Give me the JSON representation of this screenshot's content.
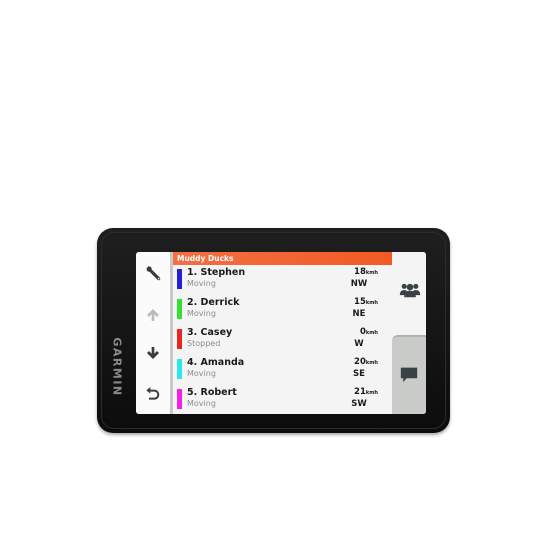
{
  "device": {
    "brand": "GARMIN"
  },
  "sidebar": {
    "buttons": [
      {
        "name": "settings",
        "icon": "wrench-icon"
      },
      {
        "name": "scroll-up",
        "icon": "arrow-up-icon"
      },
      {
        "name": "scroll-down",
        "icon": "arrow-down-icon"
      },
      {
        "name": "back",
        "icon": "back-arrow-icon"
      }
    ]
  },
  "header": {
    "title": "Muddy Ducks",
    "color": "#f25a24"
  },
  "members": [
    {
      "name": "1. Stephen",
      "status": "Moving",
      "speed": "18",
      "unit": "kmh",
      "direction": "NW",
      "color": "#2121d8"
    },
    {
      "name": "2. Derrick",
      "status": "Moving",
      "speed": "15",
      "unit": "kmh",
      "direction": "NE",
      "color": "#33e033"
    },
    {
      "name": "3. Casey",
      "status": "Stopped",
      "speed": "0",
      "unit": "kmh",
      "direction": "W",
      "color": "#e82626"
    },
    {
      "name": "4. Amanda",
      "status": "Moving",
      "speed": "20",
      "unit": "kmh",
      "direction": "SE",
      "color": "#2ee6f0"
    },
    {
      "name": "5. Robert",
      "status": "Moving",
      "speed": "21",
      "unit": "kmh",
      "direction": "SW",
      "color": "#f020e6"
    }
  ],
  "right_panel": {
    "group_icon": "group-icon",
    "message_icon": "message-icon"
  }
}
